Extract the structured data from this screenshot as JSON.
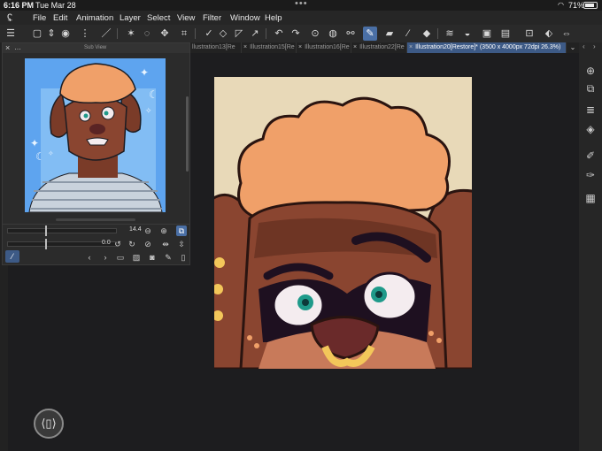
{
  "status": {
    "time": "6:16 PM",
    "date": "Tue Mar 28",
    "battery": "71%"
  },
  "menu": [
    "File",
    "Edit",
    "Animation",
    "Layer",
    "Select",
    "View",
    "Filter",
    "Window",
    "Help"
  ],
  "tabs": [
    {
      "label": "llustration13[Re"
    },
    {
      "label": "Illustration15[Re"
    },
    {
      "label": "Illustration16[Re"
    },
    {
      "label": "Illustration22[Re"
    },
    {
      "label": "Illustration20[Restore]* (3500 x 4000px 72dpi 26.3%)"
    }
  ],
  "subview": {
    "title": "Sub View",
    "zoom_value": "14.4",
    "rotate_value": "0.0",
    "zoom_level": 0.35,
    "rotate_level": 0.35
  },
  "colors": {
    "canvas_bg": "#e8d9b8",
    "hair": "#f0a069",
    "fur": "#8a4530",
    "accent": "#4a6fa5"
  }
}
